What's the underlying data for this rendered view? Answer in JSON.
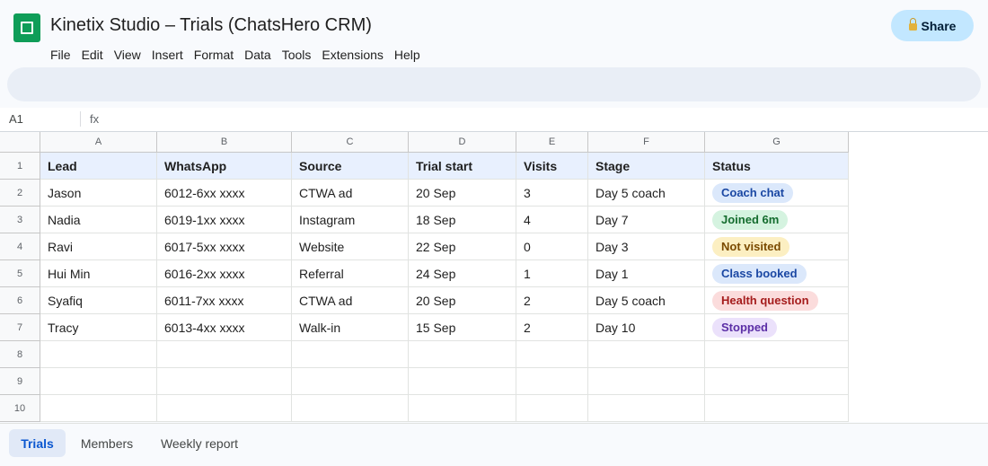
{
  "app": {
    "title": "Kinetix Studio – Trials (ChatsHero CRM)",
    "logo_icon": "sheets-logo-icon",
    "share_label": "Share",
    "share_icon": "lock-icon",
    "accent_color": "#c2e7ff"
  },
  "menu": [
    "File",
    "Edit",
    "View",
    "Insert",
    "Format",
    "Data",
    "Tools",
    "Extensions",
    "Help"
  ],
  "formula_bar": {
    "cell_ref": "A1",
    "fx_label": "fx"
  },
  "grid": {
    "column_letters": [
      "A",
      "B",
      "C",
      "D",
      "E",
      "F",
      "G"
    ],
    "row_numbers": [
      "1",
      "2",
      "3",
      "4",
      "5",
      "6",
      "7",
      "8",
      "9",
      "10"
    ],
    "headers": [
      "Lead",
      "WhatsApp",
      "Source",
      "Trial start",
      "Visits",
      "Stage",
      "Status"
    ],
    "rows": [
      {
        "lead": "Jason",
        "whatsapp": "6012-6xx xxxx",
        "source": "CTWA ad",
        "trial_start": "20 Sep",
        "visits": "3",
        "stage": "Day 5 coach",
        "status": "Coach chat"
      },
      {
        "lead": "Nadia",
        "whatsapp": "6019-1xx xxxx",
        "source": "Instagram",
        "trial_start": "18 Sep",
        "visits": "4",
        "stage": "Day 7",
        "status": "Joined 6m"
      },
      {
        "lead": "Ravi",
        "whatsapp": "6017-5xx xxxx",
        "source": "Website",
        "trial_start": "22 Sep",
        "visits": "0",
        "stage": "Day 3",
        "status": "Not visited"
      },
      {
        "lead": "Hui Min",
        "whatsapp": "6016-2xx xxxx",
        "source": "Referral",
        "trial_start": "24 Sep",
        "visits": "1",
        "stage": "Day 1",
        "status": "Class booked"
      },
      {
        "lead": "Syafiq",
        "whatsapp": "6011-7xx xxxx",
        "source": "CTWA ad",
        "trial_start": "20 Sep",
        "visits": "2",
        "stage": "Day 5 coach",
        "status": "Health question"
      },
      {
        "lead": "Tracy",
        "whatsapp": "6013-4xx xxxx",
        "source": "Walk-in",
        "trial_start": "15 Sep",
        "visits": "2",
        "stage": "Day 10",
        "status": "Stopped"
      }
    ],
    "status_colors": {
      "Coach chat": {
        "bg": "#dbe8fb",
        "fg": "#1a47a3"
      },
      "Joined 6m": {
        "bg": "#d5f3e0",
        "fg": "#146c2e"
      },
      "Not visited": {
        "bg": "#fcefc2",
        "fg": "#7a4a00"
      },
      "Class booked": {
        "bg": "#dbe8fb",
        "fg": "#1a47a3"
      },
      "Health question": {
        "bg": "#fbdcdc",
        "fg": "#a51c1c"
      },
      "Stopped": {
        "bg": "#ebe1fb",
        "fg": "#5b2ea6"
      }
    }
  },
  "sheets": {
    "tabs": [
      "Trials",
      "Members",
      "Weekly report"
    ],
    "active": "Trials"
  }
}
